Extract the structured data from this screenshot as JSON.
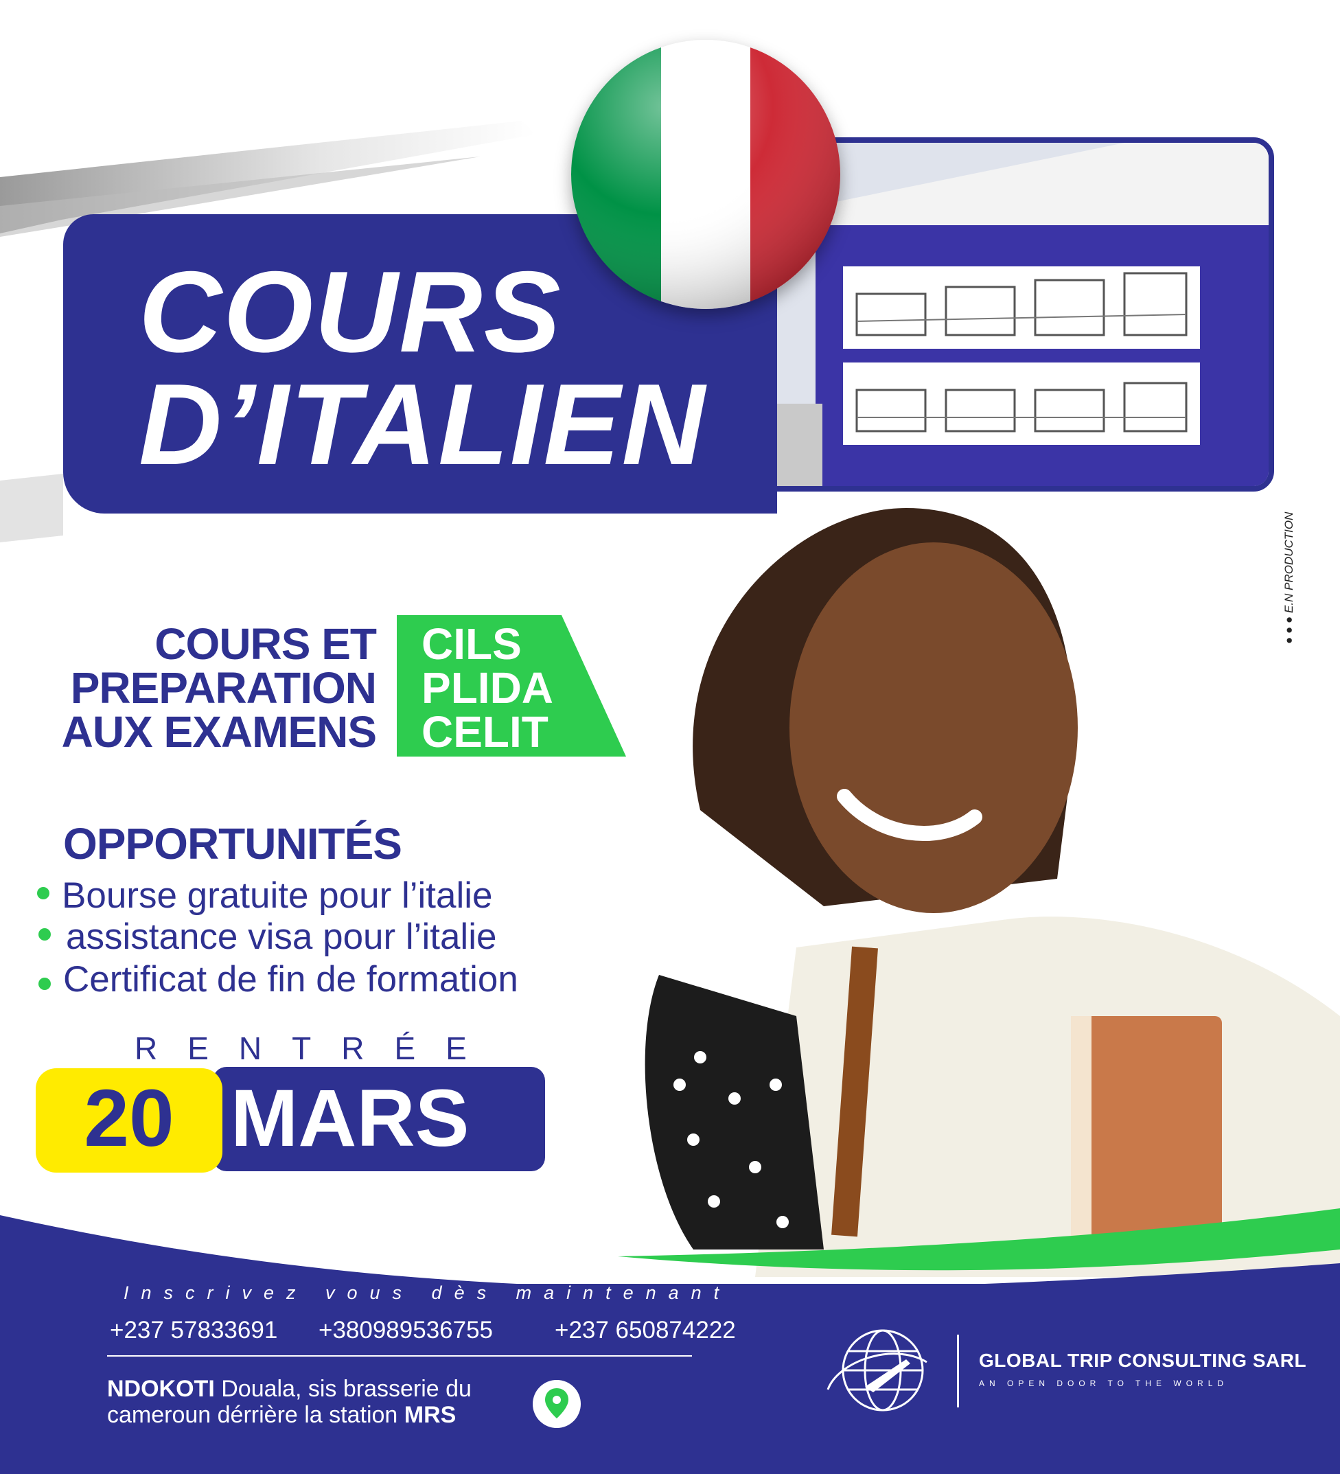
{
  "title": {
    "line1": "COURS",
    "line2": "D’ITALIEN"
  },
  "exams": {
    "heading_lines": [
      "COURS ET",
      "PREPARATION",
      "AUX EXAMENS"
    ],
    "codes": [
      "CILS",
      "PLIDA",
      "CELIT"
    ]
  },
  "opportunities": {
    "title": "OPPORTUNITÉS",
    "items": [
      "Bourse gratuite pour l’italie",
      "assistance visa pour l’italie",
      "Certificat de fin de formation"
    ]
  },
  "rentree": {
    "label": "RENTRÉE",
    "day": "20",
    "month": "MARS"
  },
  "contact": {
    "cta": "Inscrivez vous dès maintenant",
    "phones": [
      "+237 57833691",
      "+380989536755",
      "+237 650874222"
    ],
    "address_line1_bold": "NDOKOTI",
    "address_line1_rest": " Douala, sis brasserie du",
    "address_line2_rest": "cameroun dérrière la station ",
    "address_line2_bold": "MRS"
  },
  "company": {
    "name": "GLOBAL TRIP CONSULTING SARL",
    "tagline": "AN OPEN DOOR TO THE WORLD"
  },
  "credit": "E.N PRODUCTION",
  "colors": {
    "navy": "#2e3191",
    "green": "#2ecc4f",
    "yellow": "#ffeb00",
    "flag_green": "#009246",
    "flag_red": "#ce2b37"
  },
  "icons": [
    "italy-flag-icon",
    "map-pin-icon",
    "globe-airplane-logo",
    "facebook-icon",
    "youtube-icon",
    "instagram-icon"
  ]
}
